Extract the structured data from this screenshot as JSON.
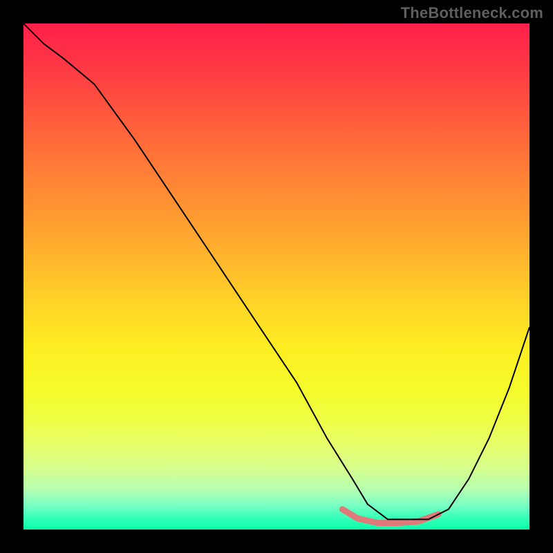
{
  "watermark": "TheBottleneck.com",
  "chart_data": {
    "type": "line",
    "title": "",
    "xlabel": "",
    "ylabel": "",
    "xlim": [
      0,
      100
    ],
    "ylim": [
      0,
      100
    ],
    "grid": false,
    "legend": false,
    "series": [
      {
        "name": "bottleneck-curve",
        "color": "#000000",
        "x": [
          0,
          4,
          8,
          14,
          22,
          30,
          38,
          46,
          54,
          60,
          65,
          68,
          72,
          76,
          80,
          84,
          88,
          92,
          96,
          100
        ],
        "y": [
          100,
          96,
          93,
          88,
          77,
          65,
          53,
          41,
          29,
          18,
          10,
          5,
          2,
          2,
          2,
          4,
          10,
          18,
          28,
          40
        ]
      },
      {
        "name": "highlight-segment",
        "color": "#e07a7a",
        "x": [
          63,
          66,
          70,
          74,
          78,
          82
        ],
        "y": [
          4,
          2.2,
          1.3,
          1.3,
          1.6,
          3
        ]
      }
    ],
    "highlight_segment": {
      "xstart": 63,
      "xend": 82
    },
    "background_gradient": {
      "top": "#ff1f4b",
      "mid": "#ffd327",
      "bottom": "#0affaa"
    }
  },
  "styling": {
    "curve_stroke": "#000000",
    "curve_stroke_width": 2,
    "highlight_stroke": "#e07a7a",
    "highlight_stroke_width": 9
  }
}
